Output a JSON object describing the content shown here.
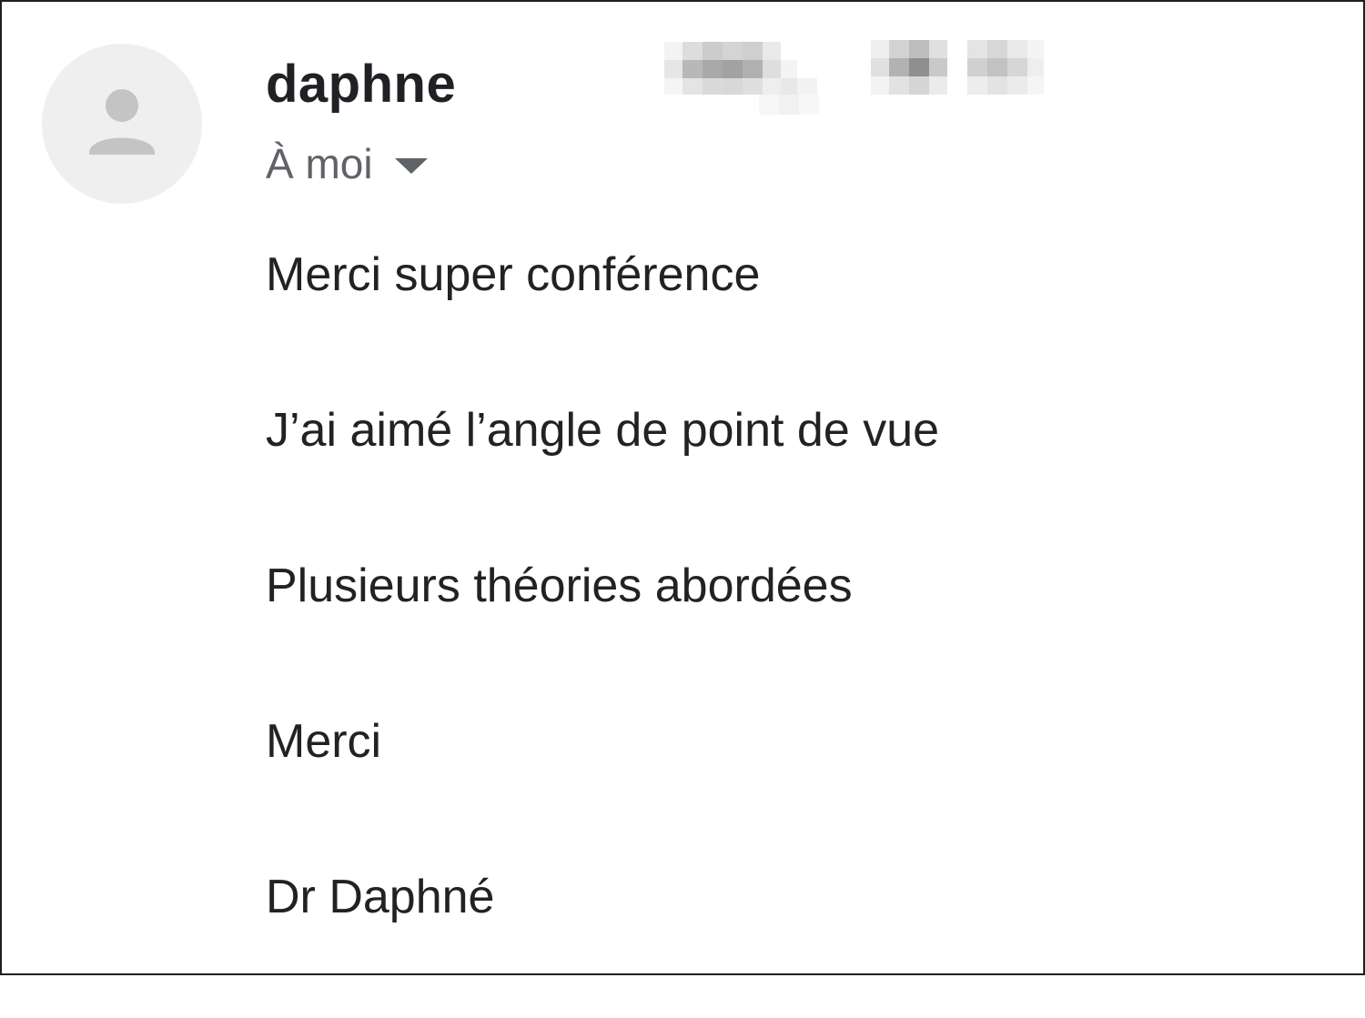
{
  "message": {
    "sender_name": "daphne",
    "recipient_label": "À moi",
    "body_lines": [
      "Merci super conférence",
      "J’ai aimé l’angle de point de vue",
      "Plusieurs théories abordées",
      "Merci",
      "Dr Daphné"
    ]
  },
  "icons": {
    "avatar": "person-icon",
    "recipient_toggle": "caret-down-icon"
  },
  "colors": {
    "sender": "#202124",
    "secondary_text": "#5f6368",
    "body_text": "#222222",
    "avatar_bg": "#efefef",
    "avatar_glyph": "#c4c4c4",
    "frame_border": "#1f1f1f"
  }
}
